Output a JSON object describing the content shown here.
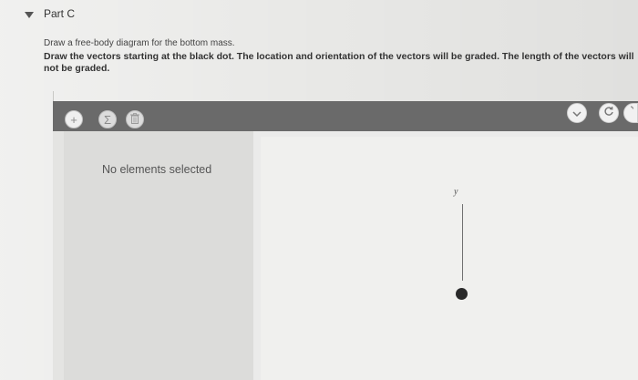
{
  "part": {
    "title": "Part C",
    "instruction": "Draw a free-body diagram for the bottom mass.",
    "instruction_bold": "Draw the vectors starting at the black dot. The location and orientation of the vectors will be graded. The length of the vectors will not be graded."
  },
  "toolbar": {
    "add_icon": "+",
    "sum_icon": "Σ",
    "trash_icon": "trash-icon",
    "chevron_icon": "chevron-down-icon",
    "reset_icon": "reset-icon",
    "help_icon": "help-icon"
  },
  "side_panel": {
    "status": "No elements selected"
  },
  "canvas": {
    "axis_label": "y"
  },
  "colors": {
    "toolbar": "#6a6a6a",
    "side_panel": "#dcdcda",
    "canvas": "#f0f0ee",
    "dot": "#2a2a2a"
  }
}
